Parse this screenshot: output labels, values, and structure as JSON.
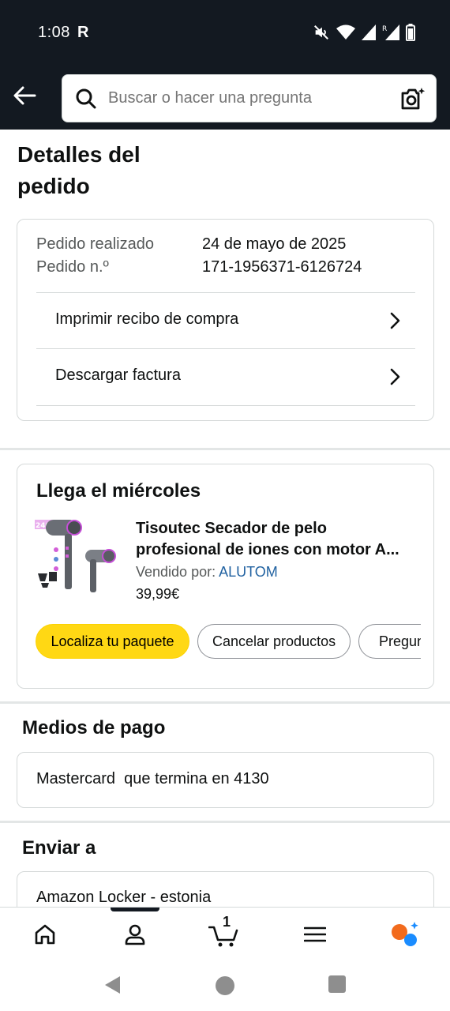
{
  "status_bar": {
    "time": "1:08",
    "carrier_glyph": "R",
    "icons": [
      "mute-icon",
      "wifi-icon",
      "signal-icon",
      "signal-roaming-icon",
      "battery-icon"
    ]
  },
  "header": {
    "back_icon": "arrow-left-icon",
    "search_placeholder": "Buscar o hacer una pregunta",
    "search_icon": "search-icon",
    "camera_icon": "camera-search-icon"
  },
  "page": {
    "title": "Detalles del pedido"
  },
  "order": {
    "placed_label": "Pedido realizado",
    "placed_value": "24 de mayo de 2025",
    "number_label": "Pedido n.º",
    "number_value": "171-1956371-6126724",
    "links": [
      {
        "label": "Imprimir recibo de compra"
      },
      {
        "label": "Descargar factura"
      }
    ]
  },
  "delivery": {
    "title": "Llega el miércoles",
    "product": {
      "title": "Tisoutec Secador de pelo profesional de iones con motor A...",
      "title_line1": "Tisoutec Secador de pelo",
      "title_line2": "profesional de iones con motor A...",
      "seller_label": "Vendido por:",
      "seller_name": "ALUTOM",
      "price": "39,99€",
      "image": "hair-dryer-product-image",
      "image_badge": "2400W"
    },
    "buttons": [
      {
        "label": "Localiza tu paquete",
        "style": "primary"
      },
      {
        "label": "Cancelar productos",
        "style": "secondary"
      },
      {
        "label": "Pregun",
        "style": "secondary"
      }
    ]
  },
  "payment": {
    "title": "Medios de pago",
    "method": "Mastercard  que termina en 4130"
  },
  "shipping": {
    "title": "Enviar a",
    "address": "Amazon Locker - estonia"
  },
  "bottom_nav": {
    "items": [
      {
        "icon": "home-icon"
      },
      {
        "icon": "account-icon",
        "active": true
      },
      {
        "icon": "cart-icon",
        "count": "1"
      },
      {
        "icon": "menu-icon"
      },
      {
        "icon": "rufus-assistant-icon"
      }
    ]
  },
  "system_nav": {
    "items": [
      "back-triangle-icon",
      "home-circle-icon",
      "recents-square-icon"
    ]
  },
  "colors": {
    "header_bg": "#131921",
    "primary_button": "#ffd814",
    "link": "#2162a1",
    "assistant_orange": "#f26b1d",
    "assistant_blue": "#1a8cff"
  }
}
